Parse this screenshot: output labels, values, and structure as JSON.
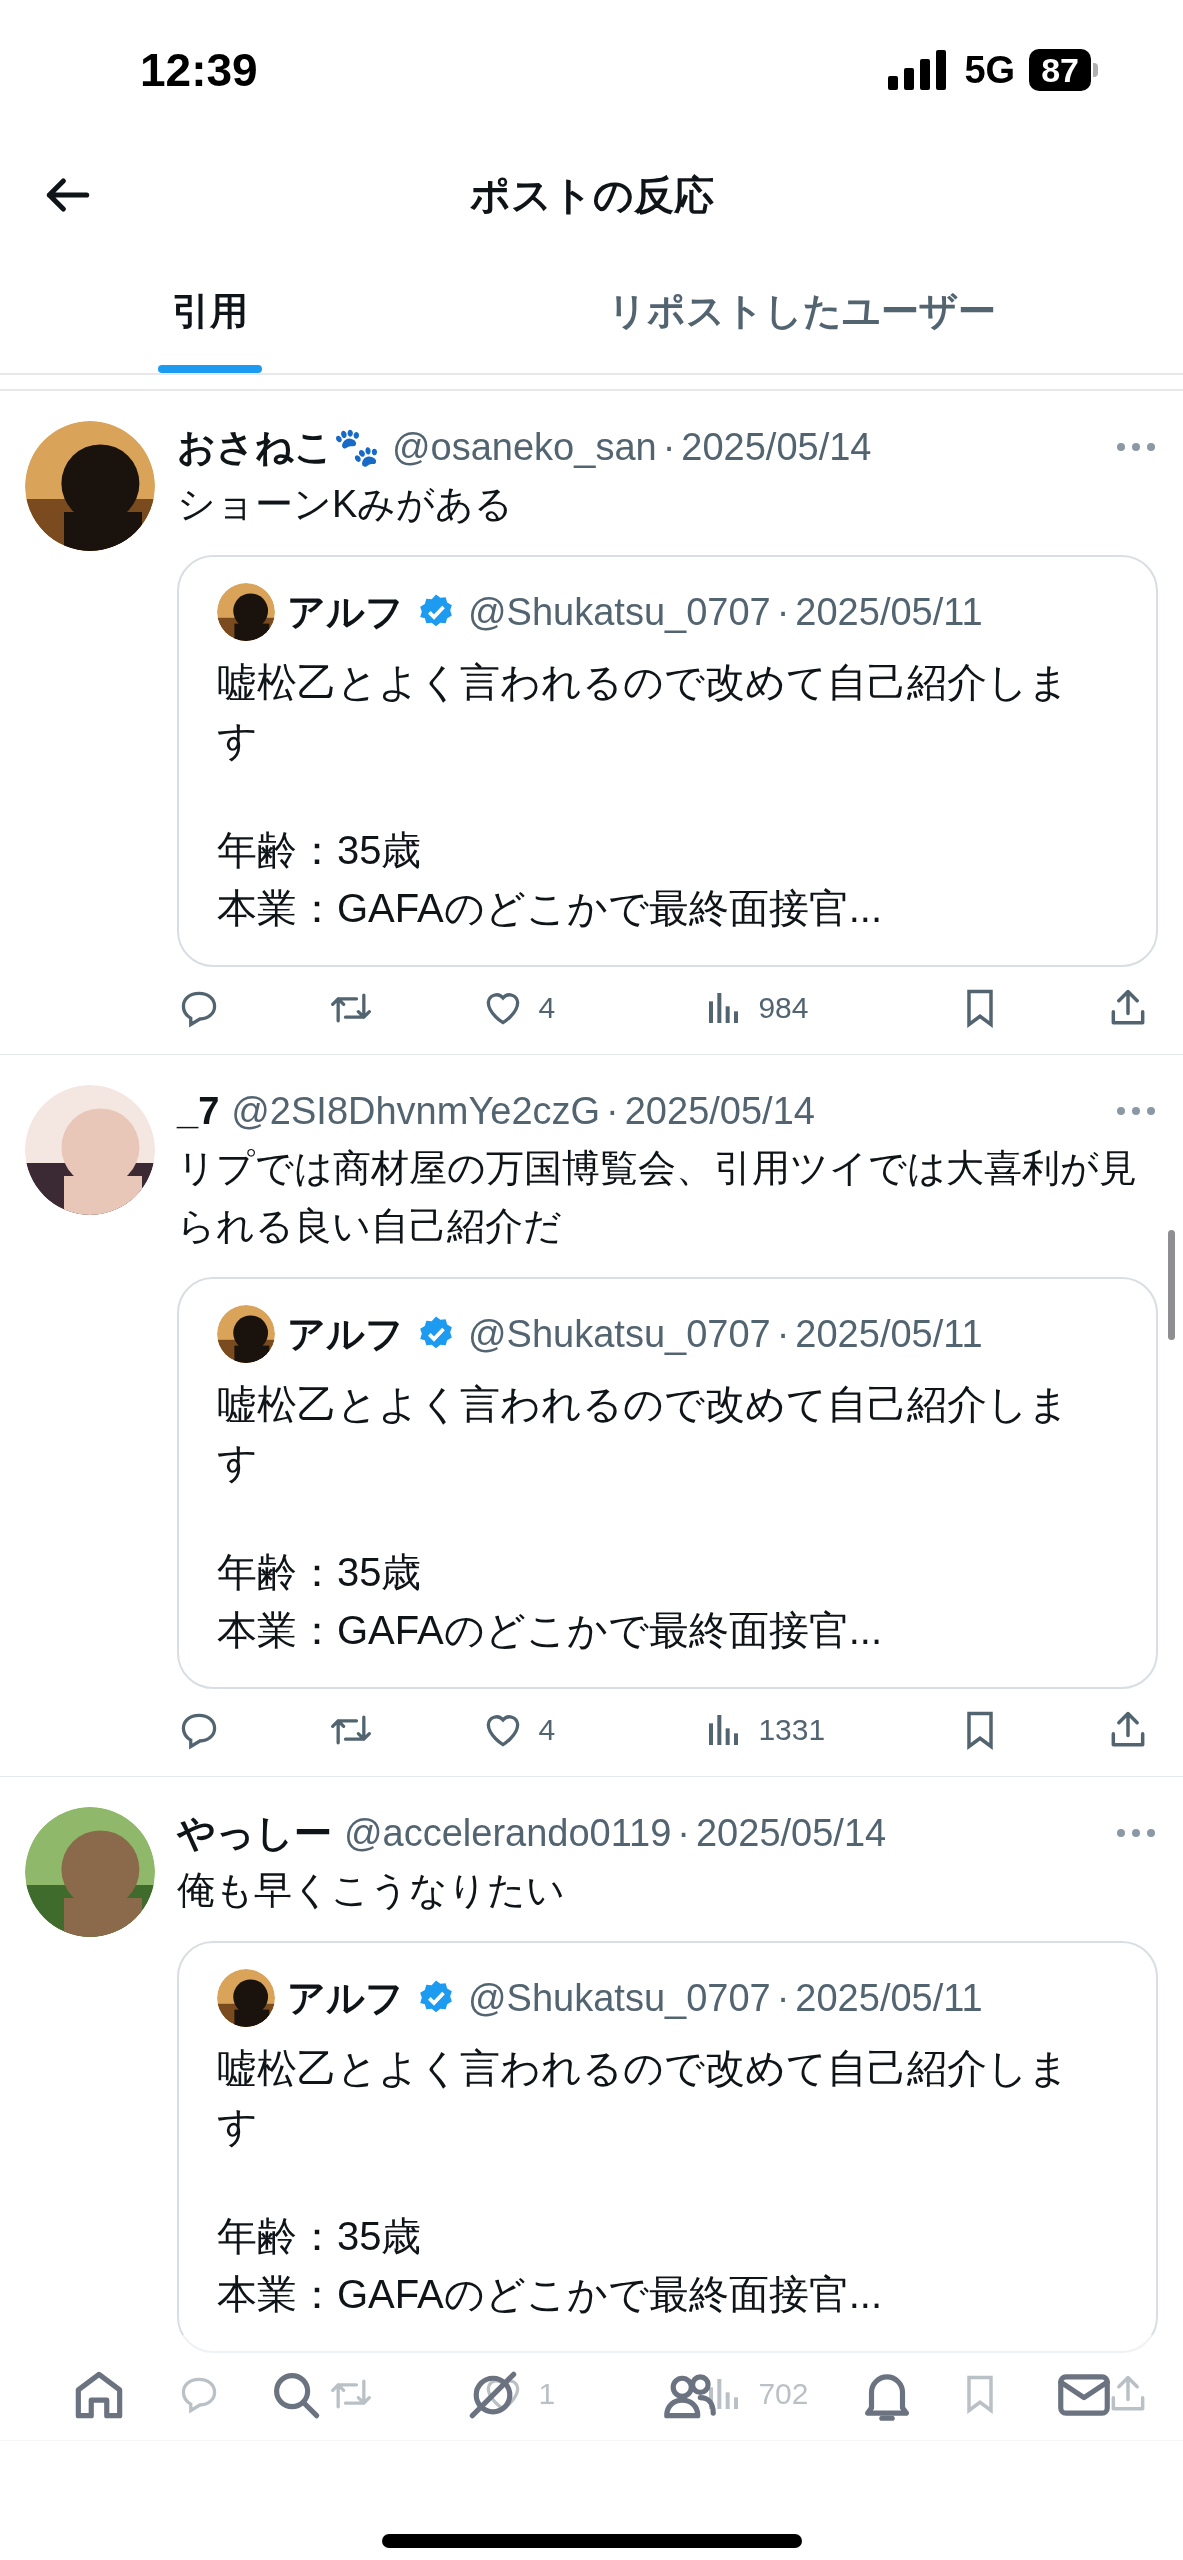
{
  "status_bar": {
    "time": "12:39",
    "network": "5G",
    "battery": "87"
  },
  "header": {
    "title": "ポストの反応"
  },
  "tabs": [
    {
      "label": "引用",
      "selected": true
    },
    {
      "label": "リポストしたユーザー",
      "selected": false
    }
  ],
  "posts": [
    {
      "name": "おさねこ🐾",
      "handle": "@osaneko_san",
      "sep": "·",
      "date": "2025/05/14",
      "text": "ショーンKみがある",
      "quote": {
        "name": "アルフ",
        "verified": true,
        "handle": "@Shukatsu_0707",
        "sep": "·",
        "date": "2025/05/11",
        "paragraphs": [
          [
            "嘘松乙とよく言われるので改めて自己紹介します"
          ],
          [
            "年齢：35歳",
            "本業：GAFAのどこかで最終面接官..."
          ]
        ]
      },
      "likes": "4",
      "views": "984"
    },
    {
      "name": "_7",
      "handle": "@2SI8DhvnmYe2czG",
      "sep": "·",
      "date": "2025/05/14",
      "text": "リプでは商材屋の万国博覧会、引用ツイでは大喜利が見られる良い自己紹介だ",
      "quote": {
        "name": "アルフ",
        "verified": true,
        "handle": "@Shukatsu_0707",
        "sep": "·",
        "date": "2025/05/11",
        "paragraphs": [
          [
            "嘘松乙とよく言われるので改めて自己紹介します"
          ],
          [
            "年齢：35歳",
            "本業：GAFAのどこかで最終面接官..."
          ]
        ]
      },
      "likes": "4",
      "views": "1331"
    },
    {
      "name": "やっしー",
      "handle": "@accelerando0119",
      "sep": "·",
      "date": "2025/05/14",
      "text": "俺も早くこうなりたい",
      "quote": {
        "name": "アルフ",
        "verified": true,
        "handle": "@Shukatsu_0707",
        "sep": "·",
        "date": "2025/05/11",
        "paragraphs": [
          [
            "嘘松乙とよく言われるので改めて自己紹介します"
          ],
          [
            "年齢：35歳",
            "本業：GAFAのどこかで最終面接官..."
          ]
        ]
      },
      "likes": "1",
      "views": "702"
    }
  ],
  "bottom_nav": [
    {
      "kind": "home"
    },
    {
      "kind": "search"
    },
    {
      "kind": "grok"
    },
    {
      "kind": "people"
    },
    {
      "kind": "bell"
    },
    {
      "kind": "mail"
    }
  ]
}
